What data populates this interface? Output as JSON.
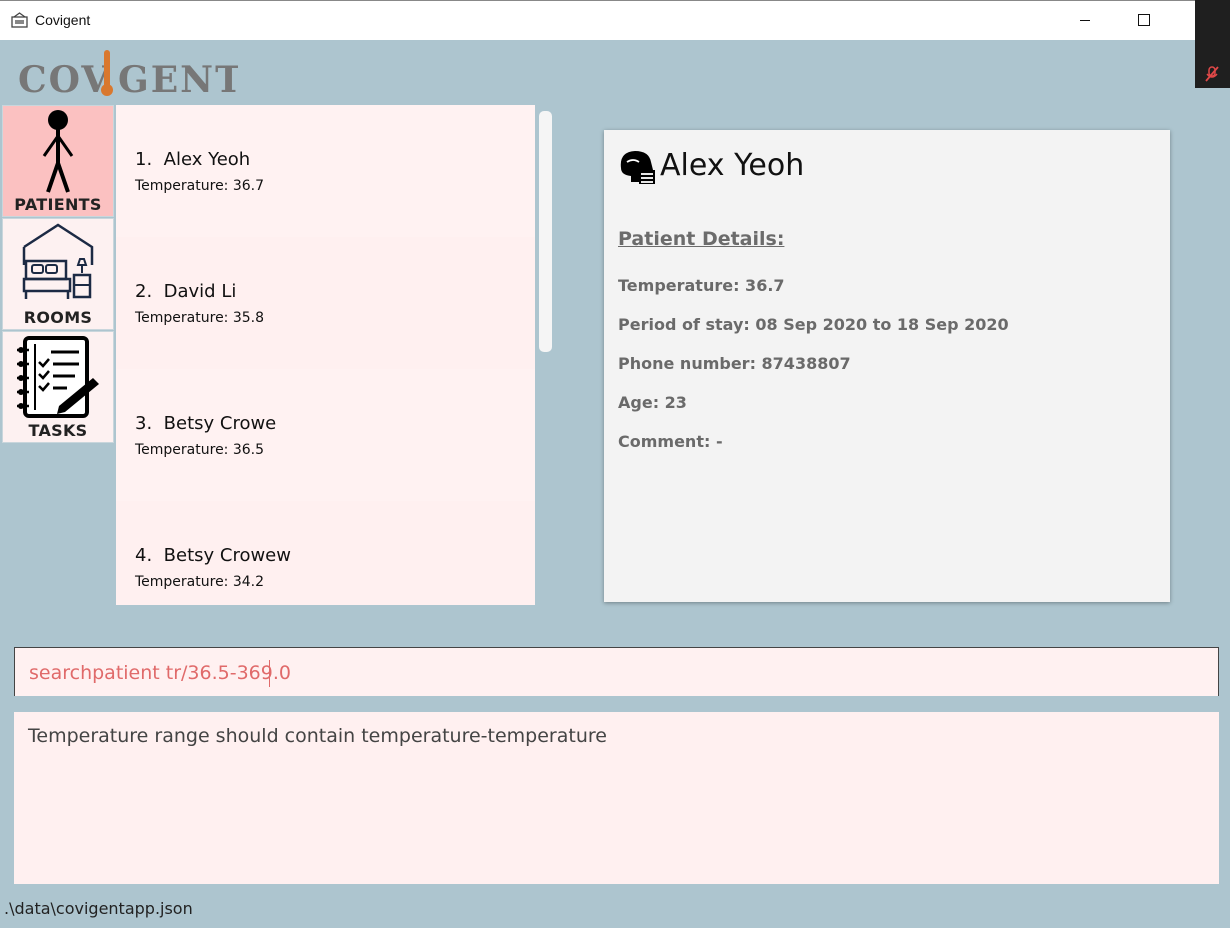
{
  "window": {
    "title": "Covigent"
  },
  "logo": {
    "text_left": "COV",
    "text_right": "GENT"
  },
  "nav": [
    {
      "label": "PATIENTS",
      "icon": "stick-figure-icon",
      "active": true
    },
    {
      "label": "ROOMS",
      "icon": "bedroom-icon",
      "active": false
    },
    {
      "label": "TASKS",
      "icon": "checklist-icon",
      "active": false
    }
  ],
  "patients": [
    {
      "index": "1.",
      "name": "Alex Yeoh",
      "temperature": "Temperature: 36.7"
    },
    {
      "index": "2.",
      "name": "David Li",
      "temperature": "Temperature: 35.8"
    },
    {
      "index": "3.",
      "name": "Betsy Crowe",
      "temperature": "Temperature: 36.5"
    },
    {
      "index": "4.",
      "name": "Betsy Crowew",
      "temperature": "Temperature: 34.2"
    }
  ],
  "details": {
    "name": "Alex Yeoh",
    "section_title": "Patient Details:",
    "temperature": "Temperature: 36.7",
    "stay": "Period of stay: 08 Sep 2020 to 18 Sep 2020",
    "phone": "Phone number: 87438807",
    "age": "Age: 23",
    "comment": "Comment: -"
  },
  "command": {
    "value": "searchpatient tr/36.5-369.0"
  },
  "result": {
    "message": "Temperature range should contain temperature-temperature"
  },
  "status": {
    "path": ".\\data\\covigentapp.json"
  },
  "colors": {
    "active_nav": "#fbc1c1",
    "background": "#adc5cf",
    "panel": "#fff2f2",
    "command_text": "#e06a6a"
  }
}
